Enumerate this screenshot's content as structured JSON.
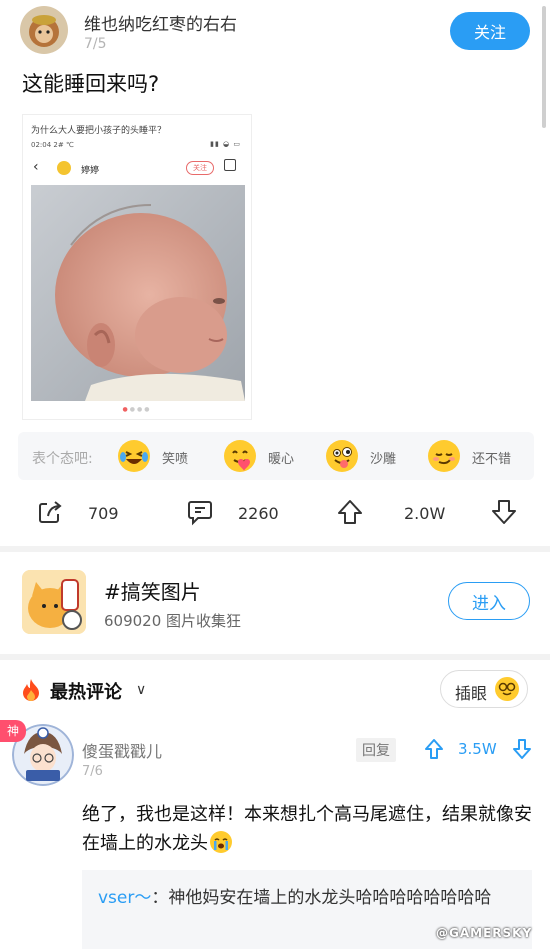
{
  "post": {
    "username": "维也纳吃红枣的右右",
    "date": "7/5",
    "follow_label": "关注",
    "title": "这能睡回来吗?"
  },
  "embedded_screenshot": {
    "question": "为什么大人要把小孩子的头睡平？",
    "status_time": "02:04 2# ℃",
    "author": "婷婷",
    "follow_label": "关注"
  },
  "reactions": {
    "prompt": "表个态吧:",
    "items": [
      {
        "icon": "laugh-tears-emoji",
        "label": "笑喷"
      },
      {
        "icon": "heart-hug-emoji",
        "label": "暖心"
      },
      {
        "icon": "silly-tongue-emoji",
        "label": "沙雕"
      },
      {
        "icon": "smug-emoji",
        "label": "还不错"
      }
    ]
  },
  "actions": {
    "share_count": "709",
    "comment_count": "2260",
    "upvote_count": "2.0W"
  },
  "topic": {
    "title": "#搞笑图片",
    "meta": "609020 图片收集狂",
    "enter_label": "进入"
  },
  "comments_header": {
    "label": "最热评论",
    "insert_label": "插眼"
  },
  "comment": {
    "badge": "神",
    "username": "傻蛋戳戳儿",
    "date": "7/6",
    "reply_label": "回复",
    "upvotes": "3.5W",
    "text": "绝了，我也是这样！本来想扎个高马尾遮住，结果就像安在墙上的水龙头",
    "reply": {
      "user": "vser～",
      "text": "神他妈安在墙上的水龙头哈哈哈哈哈哈哈哈"
    }
  },
  "watermark": "@GAMERSKY",
  "colors": {
    "accent": "#2a9df4",
    "badge": "#ff4f6e"
  }
}
